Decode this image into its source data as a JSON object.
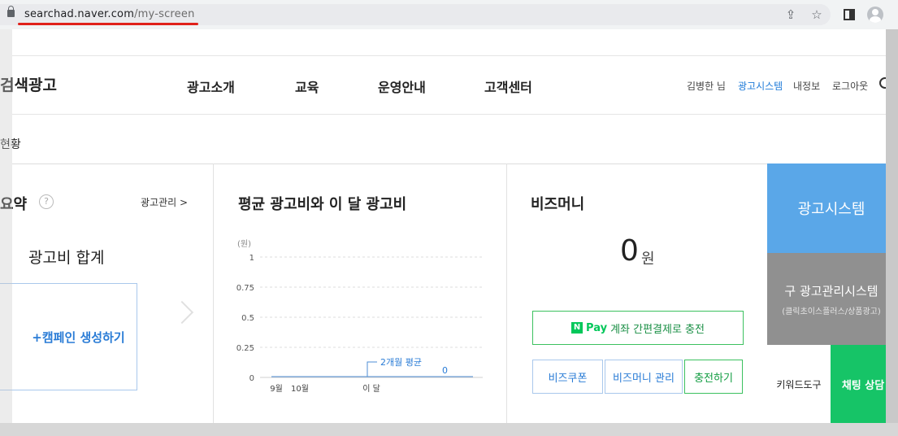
{
  "browser": {
    "url_host": "searchad.naver.com",
    "url_path": "/my-screen"
  },
  "header": {
    "logo": "검색광고",
    "nav": [
      "광고소개",
      "교육",
      "운영안내",
      "고객센터"
    ],
    "user_name": "김병한 님",
    "ad_system": "광고시스템",
    "my_info": "내정보",
    "logout": "로그아웃"
  },
  "section_title": "현황",
  "summary": {
    "title": "요약",
    "help": "?",
    "manage_link": "광고관리 >",
    "total_label": "광고비 합계",
    "create_campaign": "+캠페인 생성하기"
  },
  "cost_chart": {
    "title": "평균 광고비와 이 달 광고비"
  },
  "chart_data": {
    "type": "line",
    "ylabel": "(원)",
    "ylim": [
      0,
      1
    ],
    "y_ticks": [
      "1",
      "0.75",
      "0.5",
      "0.25",
      "0"
    ],
    "x_ticks": [
      "9월",
      "10월",
      "이 달"
    ],
    "series": [
      {
        "name": "2개월 평균",
        "values": [
          0,
          0
        ]
      },
      {
        "values": [
          0
        ]
      }
    ],
    "annotations": [
      "2개월 평균",
      "0"
    ],
    "grid": true
  },
  "bizmoney": {
    "title": "비즈머니",
    "amount": "0",
    "unit": "원",
    "npay_icon": "N",
    "npay_pay": "Pay",
    "npay_text": "계좌 간편결제로 충전",
    "coupon": "비즈쿠폰",
    "manage": "비즈머니 관리",
    "charge": "충전하기"
  },
  "shortcuts": {
    "ad_system": "광고시스템",
    "old_system": "구 광고관리시스템",
    "old_system_sub": "(클릭초이스플러스/상품광고)",
    "keyword_tool": "키워드도구",
    "chat": "채팅 상담"
  },
  "colors": {
    "accent_blue": "#5aa7e8",
    "naver_green": "#03c75a",
    "url_underline": "#e0201a"
  }
}
